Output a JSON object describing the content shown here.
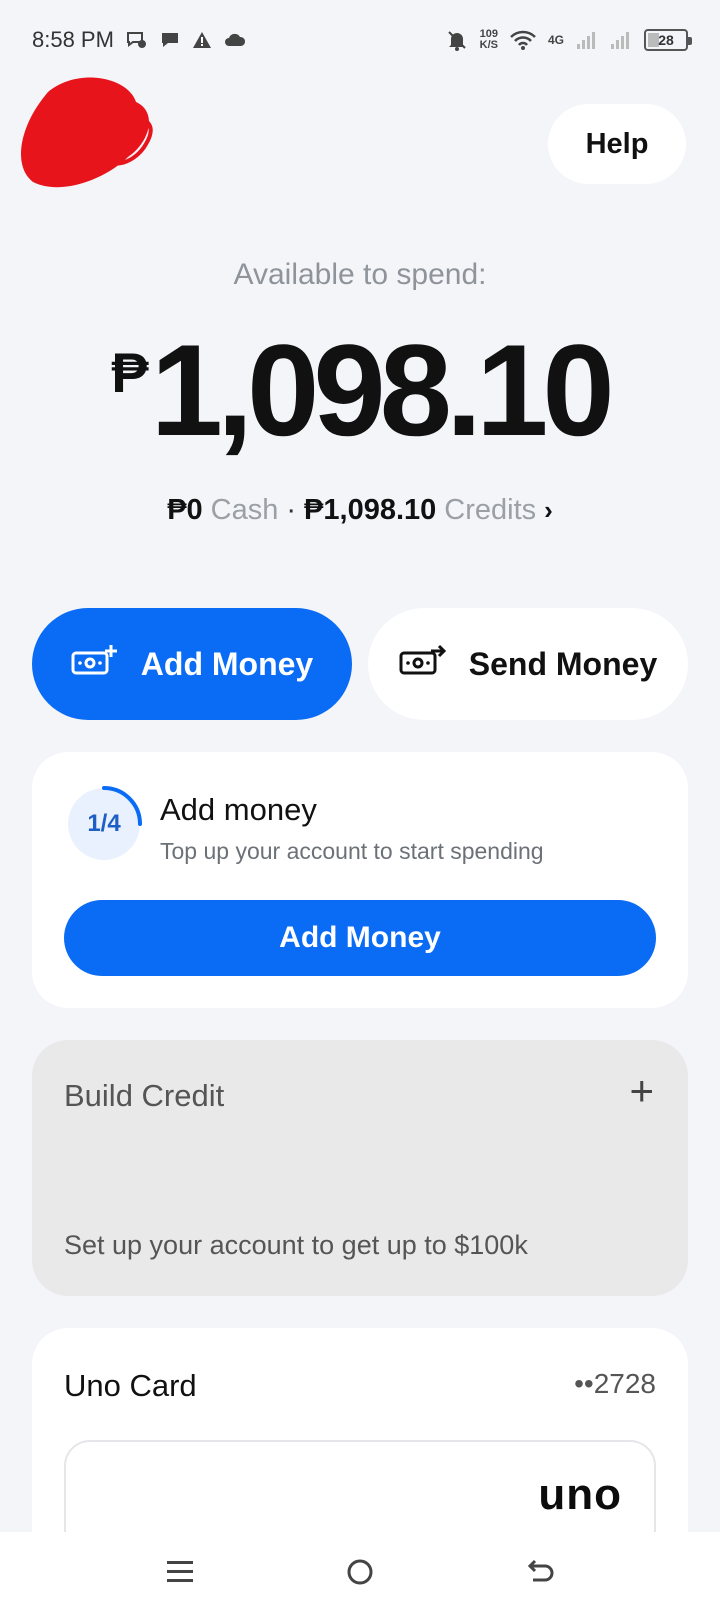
{
  "status_bar": {
    "time": "8:58 PM",
    "net_speed_value": "109",
    "net_speed_unit": "K/S",
    "network_type": "4G",
    "battery_level": "28"
  },
  "header": {
    "help_label": "Help"
  },
  "balance": {
    "label": "Available to spend:",
    "currency": "₱",
    "amount": "1,098.10",
    "cash_value": "₱0",
    "cash_label": "Cash",
    "separator": "·",
    "credits_value": "₱1,098.10",
    "credits_label": "Credits",
    "chevron": "›"
  },
  "actions": {
    "add_money": "Add Money",
    "send_money": "Send Money"
  },
  "onboarding": {
    "progress": "1/4",
    "progress_fraction": 0.25,
    "title": "Add money",
    "subtitle": "Top up your account to start spending",
    "button": "Add Money"
  },
  "build_credit": {
    "title": "Build Credit",
    "plus": "+",
    "subtitle": "Set up your account to get up to $100k"
  },
  "uno_card": {
    "title": "Uno Card",
    "last4": "••2728",
    "logo": "uno"
  },
  "colors": {
    "accent": "#0a6cf5",
    "background": "#f3f5f9",
    "redaction": "#e8141b"
  }
}
